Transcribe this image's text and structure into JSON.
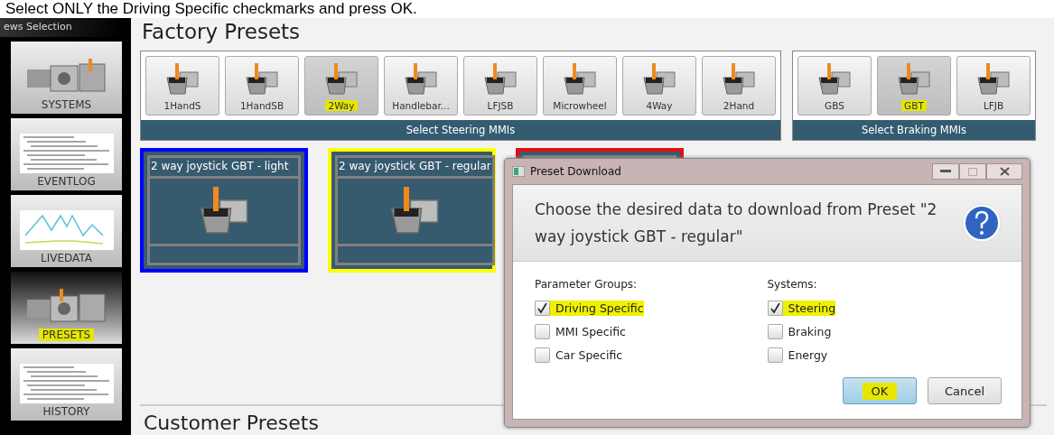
{
  "instruction": "Select ONLY the Driving Specific checkmarks and press OK.",
  "sidebar": {
    "title": "ews Selection",
    "items": [
      {
        "label": "SYSTEMS",
        "kind": "systems",
        "selected": false,
        "highlighted": false
      },
      {
        "label": "EVENTLOG",
        "kind": "document",
        "selected": false,
        "highlighted": false
      },
      {
        "label": "LIVEDATA",
        "kind": "chart",
        "selected": false,
        "highlighted": false
      },
      {
        "label": "PRESETS",
        "kind": "presets",
        "selected": true,
        "highlighted": true
      },
      {
        "label": "HISTORY",
        "kind": "document",
        "selected": false,
        "highlighted": false
      }
    ]
  },
  "factory_presets": {
    "title": "Factory Presets",
    "steering": {
      "caption": "Select Steering MMIs",
      "items": [
        {
          "label": "1HandS",
          "selected": false,
          "highlighted": false
        },
        {
          "label": "1HandSB",
          "selected": false,
          "highlighted": false
        },
        {
          "label": "2Way",
          "selected": true,
          "highlighted": true
        },
        {
          "label": "Handlebar...",
          "selected": false,
          "highlighted": false
        },
        {
          "label": "LFJSB",
          "selected": false,
          "highlighted": false
        },
        {
          "label": "Microwheel",
          "selected": false,
          "highlighted": false
        },
        {
          "label": "4Way",
          "selected": false,
          "highlighted": false
        },
        {
          "label": "2Hand",
          "selected": false,
          "highlighted": false
        }
      ]
    },
    "braking": {
      "caption": "Select Braking MMIs",
      "items": [
        {
          "label": "GBS",
          "selected": false,
          "highlighted": false
        },
        {
          "label": "GBT",
          "selected": true,
          "highlighted": true
        },
        {
          "label": "LFJB",
          "selected": false,
          "highlighted": false
        }
      ]
    },
    "cards": [
      {
        "title": "2 way joystick GBT - light",
        "color": "#0000ff"
      },
      {
        "title": "2 way joystick GBT - regular",
        "color": "#ffff00"
      },
      {
        "color": "#e01010"
      }
    ]
  },
  "customer_presets": {
    "title": "Customer Presets"
  },
  "dialog": {
    "title": "Preset Download",
    "message": "Choose the desired data to download from Preset \"2 way joystick GBT - regular\"",
    "parameter_groups": {
      "heading": "Parameter Groups:",
      "items": [
        {
          "label": "Driving Specific",
          "checked": true,
          "highlighted": true
        },
        {
          "label": "MMI Specific",
          "checked": false,
          "highlighted": false
        },
        {
          "label": "Car Specific",
          "checked": false,
          "highlighted": false
        }
      ]
    },
    "systems": {
      "heading": "Systems:",
      "items": [
        {
          "label": "Steering",
          "checked": true,
          "highlighted": true
        },
        {
          "label": "Braking",
          "checked": false,
          "highlighted": false
        },
        {
          "label": "Energy",
          "checked": false,
          "highlighted": false
        }
      ]
    },
    "buttons": [
      {
        "label": "OK",
        "default": true,
        "highlighted": true
      },
      {
        "label": "Cancel",
        "default": false,
        "highlighted": false
      }
    ]
  }
}
